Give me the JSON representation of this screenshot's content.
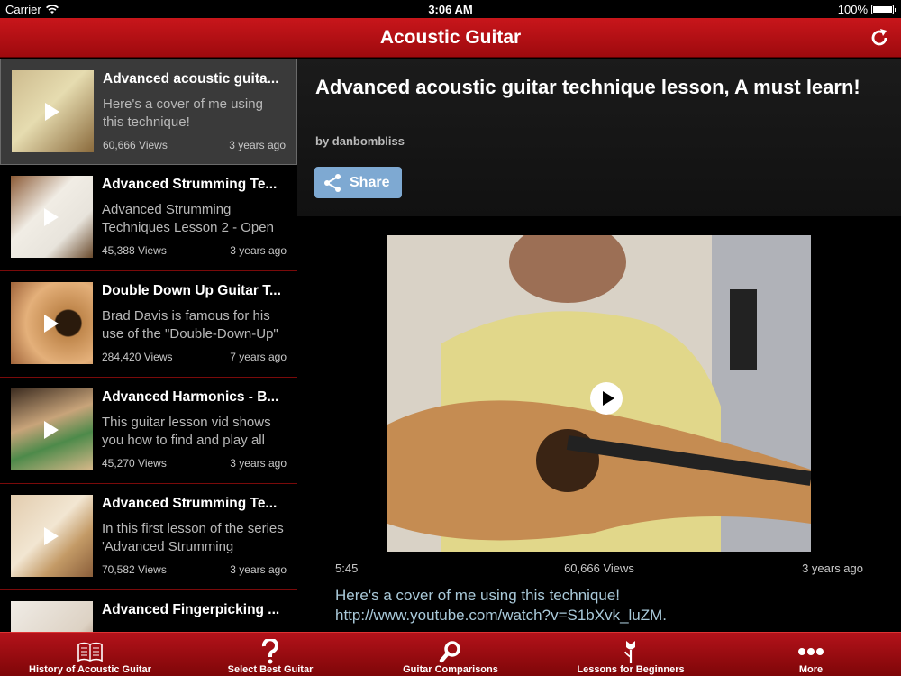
{
  "status_bar": {
    "carrier": "Carrier",
    "time": "3:06 AM",
    "battery": "100%",
    "battery_level": 1.0
  },
  "nav": {
    "title": "Acoustic Guitar",
    "refresh_icon": "refresh-icon"
  },
  "list": [
    {
      "title": "Advanced acoustic guita...",
      "description": "Here's a cover of me using this technique!",
      "views": "60,666 Views",
      "age": "3 years ago",
      "selected": true
    },
    {
      "title": "Advanced Strumming Te...",
      "description": "Advanced Strumming Techniques Lesson 2 - Open",
      "views": "45,388 Views",
      "age": "3 years ago",
      "selected": false
    },
    {
      "title": "Double Down Up Guitar T...",
      "description": "Brad Davis is famous for his use of the \"Double-Down-Up\"",
      "views": "284,420 Views",
      "age": "7 years ago",
      "selected": false
    },
    {
      "title": "Advanced Harmonics - B...",
      "description": "This guitar lesson vid shows you how to find and play all",
      "views": "45,270 Views",
      "age": "3 years ago",
      "selected": false
    },
    {
      "title": "Advanced Strumming Te...",
      "description": "In this first lesson of the series 'Advanced Strumming",
      "views": "70,582 Views",
      "age": "3 years ago",
      "selected": false
    },
    {
      "title": "Advanced Fingerpicking ...",
      "description": "",
      "views": "",
      "age": "",
      "selected": false
    }
  ],
  "detail": {
    "title": "Advanced acoustic guitar technique lesson, A must learn!",
    "byline": "by danbombliss",
    "share_label": "Share",
    "duration": "5:45",
    "views": "60,666 Views",
    "age": "3 years ago",
    "description_line1": "Here's a cover of me using this technique!",
    "description_line2": "http://www.youtube.com/watch?v=S1bXvk_luZM."
  },
  "tabs": [
    {
      "label": "History of Acoustic Guitar",
      "icon": "book-icon"
    },
    {
      "label": "Select Best Guitar",
      "icon": "question-icon"
    },
    {
      "label": "Guitar Comparisons",
      "icon": "magnifier-icon"
    },
    {
      "label": "Lessons for Beginners",
      "icon": "flower-icon"
    },
    {
      "label": "More",
      "icon": "more-dots-icon"
    }
  ],
  "colors": {
    "nav_red": "#b5141a",
    "list_divider": "#7a0a0a",
    "share_blue": "#7ea9d2",
    "desc_text": "#a9c9d9"
  }
}
